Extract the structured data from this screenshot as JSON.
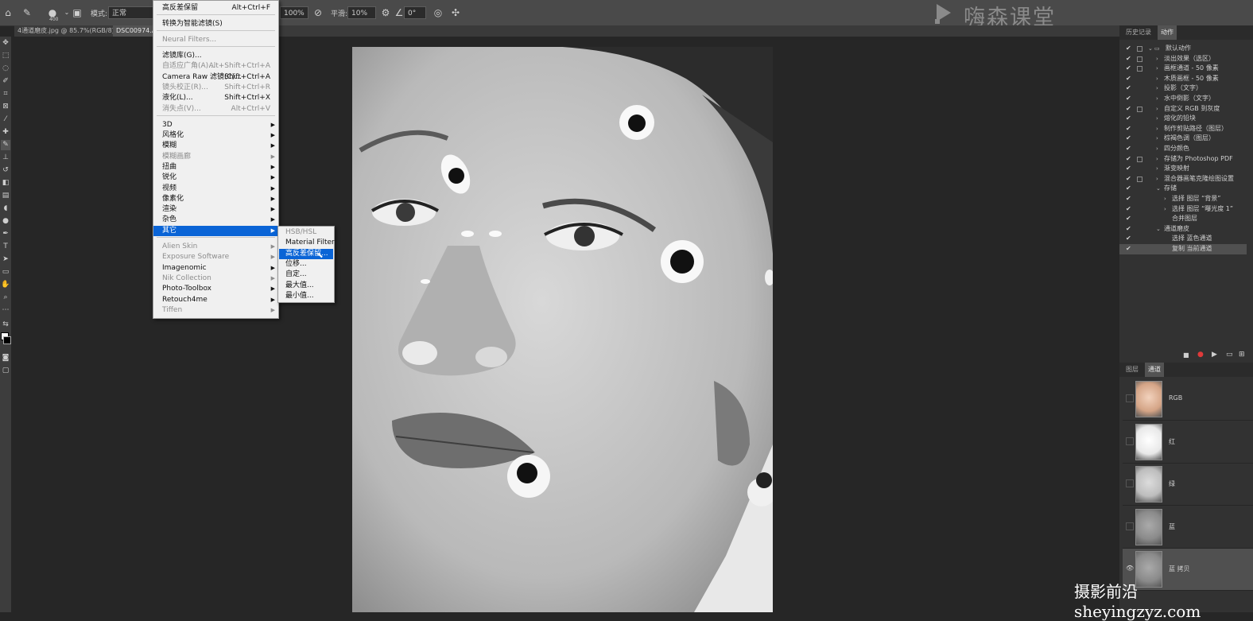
{
  "options_bar": {
    "brush_size": "400",
    "mode_label": "模式:",
    "mode_value": "正常",
    "opacity_value": "100%",
    "smooth_label": "平滑:",
    "smooth_value": "10%",
    "angle_value": "0°"
  },
  "doc_tabs": [
    {
      "label": "4通道磨皮.jpg @ 85.7%(RGB/8)",
      "close": "×"
    },
    {
      "label": "DSC00974.AR"
    }
  ],
  "watermark_top": "嗨森课堂",
  "watermark_bottom": "摄影前沿sheyingzyz.com",
  "filter_menu": {
    "items": [
      {
        "label": "高反差保留",
        "shortcut": "Alt+Ctrl+F"
      },
      {
        "label": "转换为智能滤镜(S)"
      },
      {
        "label": "Neural Filters...",
        "disabled": true
      },
      {
        "label": "滤镜库(G)..."
      },
      {
        "label": "自适应广角(A)...",
        "shortcut": "Alt+Shift+Ctrl+A",
        "disabled": true
      },
      {
        "label": "Camera Raw 滤镜(C)...",
        "shortcut": "Shift+Ctrl+A"
      },
      {
        "label": "镜头校正(R)...",
        "shortcut": "Shift+Ctrl+R",
        "disabled": true
      },
      {
        "label": "液化(L)...",
        "shortcut": "Shift+Ctrl+X"
      },
      {
        "label": "消失点(V)...",
        "shortcut": "Alt+Ctrl+V",
        "disabled": true
      },
      {
        "label": "3D",
        "sub": true
      },
      {
        "label": "风格化",
        "sub": true
      },
      {
        "label": "模糊",
        "sub": true
      },
      {
        "label": "模糊画廊",
        "sub": true,
        "disabled": true
      },
      {
        "label": "扭曲",
        "sub": true
      },
      {
        "label": "锐化",
        "sub": true
      },
      {
        "label": "视频",
        "sub": true
      },
      {
        "label": "像素化",
        "sub": true
      },
      {
        "label": "渲染",
        "sub": true
      },
      {
        "label": "杂色",
        "sub": true
      },
      {
        "label": "其它",
        "sub": true,
        "highlight": true
      },
      {
        "label": "Alien Skin",
        "sub": true,
        "disabled": true
      },
      {
        "label": "Exposure Software",
        "sub": true,
        "disabled": true
      },
      {
        "label": "Imagenomic",
        "sub": true
      },
      {
        "label": "Nik Collection",
        "sub": true,
        "disabled": true
      },
      {
        "label": "Photo-Toolbox",
        "sub": true
      },
      {
        "label": "Retouch4me",
        "sub": true
      },
      {
        "label": "Tiffen",
        "sub": true,
        "disabled": true
      }
    ]
  },
  "other_submenu": {
    "items": [
      {
        "label": "HSB/HSL",
        "disabled": true
      },
      {
        "label": "Material Filter"
      },
      {
        "label": "高反差保留...",
        "highlight": true
      },
      {
        "label": "位移..."
      },
      {
        "label": "自定..."
      },
      {
        "label": "最大值..."
      },
      {
        "label": "最小值..."
      }
    ]
  },
  "panel_tabs_top": [
    "历史记录",
    "动作"
  ],
  "actions": [
    {
      "label": "默认动作",
      "level": 0,
      "folder": true
    },
    {
      "label": "淡出效果（选区）",
      "level": 1,
      "dialog": true
    },
    {
      "label": "画框通道 - 50 像素",
      "level": 1,
      "dialog": true
    },
    {
      "label": "木质画框 - 50 像素",
      "level": 1
    },
    {
      "label": "投影（文字）",
      "level": 1
    },
    {
      "label": "水中倒影（文字）",
      "level": 1
    },
    {
      "label": "自定义 RGB 到灰度",
      "level": 1,
      "dialog": true
    },
    {
      "label": "熔化的铅块",
      "level": 1
    },
    {
      "label": "制作剪贴路径（图层）",
      "level": 1
    },
    {
      "label": "棕褐色调（图层）",
      "level": 1
    },
    {
      "label": "四分颜色",
      "level": 1
    },
    {
      "label": "存储为 Photoshop PDF",
      "level": 1,
      "dialog": true
    },
    {
      "label": "渐变映射",
      "level": 1
    },
    {
      "label": "混合器画笔克隆绘图设置",
      "level": 1,
      "dialog": true
    },
    {
      "label": "存储",
      "level": 1,
      "open": true
    },
    {
      "label": "选择 图层 “背景”",
      "level": 2
    },
    {
      "label": "选择 图层 “曝光度 1”",
      "level": 2
    },
    {
      "label": "合并图层",
      "level": 2,
      "noarrow": true
    },
    {
      "label": "通道磨皮",
      "level": 1,
      "open": true
    },
    {
      "label": "选择 蓝色通道",
      "level": 2,
      "noarrow": true
    },
    {
      "label": "复制 当前通道",
      "level": 2,
      "noarrow": true,
      "selected": true
    }
  ],
  "panel_tabs_bottom": [
    "图层",
    "通道"
  ],
  "channels": [
    {
      "label": "RGB",
      "tone": "color"
    },
    {
      "label": "红",
      "tone": "light"
    },
    {
      "label": "绿",
      "tone": "mid"
    },
    {
      "label": "蓝",
      "tone": "dark"
    },
    {
      "label": "蓝 拷贝",
      "tone": "dark",
      "selected": true,
      "visible": true
    }
  ]
}
